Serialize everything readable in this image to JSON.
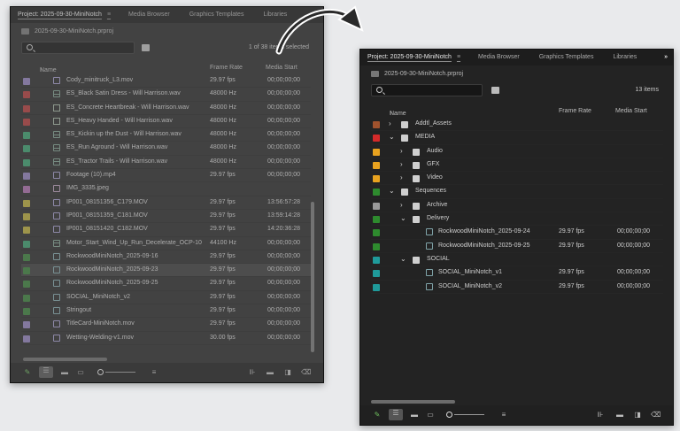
{
  "left_panel": {
    "tabs": [
      {
        "label": "Project: 2025-09-30-MiniNotch",
        "active": true
      },
      {
        "label": "Media Browser"
      },
      {
        "label": "Graphics Templates"
      },
      {
        "label": "Libraries"
      }
    ],
    "project_file": "2025-09-30-MiniNotch.prproj",
    "item_count": "1 of 38 items selected",
    "columns": {
      "name": "Name",
      "frame_rate": "Frame Rate",
      "media_start": "Media Start"
    },
    "rows": [
      {
        "color": "#8f7fb8",
        "icon": "video-icon",
        "name": "Cody_minitruck_L3.mov",
        "frame_rate": "29.97 fps",
        "media_start": "00;00;00;00"
      },
      {
        "color": "#b03a3a",
        "icon": "audio-icon",
        "name": "ES_Black Satin Dress - Will Harrison.wav",
        "frame_rate": "48000 Hz",
        "media_start": "00;00;00;00"
      },
      {
        "color": "#b03a3a",
        "icon": "file-icon",
        "name": "ES_Concrete Heartbreak - Will Harrison.wav",
        "frame_rate": "48000 Hz",
        "media_start": "00;00;00;00"
      },
      {
        "color": "#b03a3a",
        "icon": "file-icon",
        "name": "ES_Heavy Handed - Will Harrison.wav",
        "frame_rate": "48000 Hz",
        "media_start": "00;00;00;00"
      },
      {
        "color": "#3a9c6c",
        "icon": "audio-icon",
        "name": "ES_Kickin up the Dust - Will Harrison.wav",
        "frame_rate": "48000 Hz",
        "media_start": "00;00;00;00"
      },
      {
        "color": "#3a9c6c",
        "icon": "audio-icon",
        "name": "ES_Run Aground - Will Harrison.wav",
        "frame_rate": "48000 Hz",
        "media_start": "00;00;00;00"
      },
      {
        "color": "#3a9c6c",
        "icon": "audio-icon",
        "name": "ES_Tractor Trails - Will Harrison.wav",
        "frame_rate": "48000 Hz",
        "media_start": "00;00;00;00"
      },
      {
        "color": "#8f7fb8",
        "icon": "video-icon",
        "name": "Footage (10).mp4",
        "frame_rate": "29.97 fps",
        "media_start": "00;00;00;00"
      },
      {
        "color": "#a86aa8",
        "icon": "image-icon",
        "name": "IMG_3335.jpeg",
        "frame_rate": "",
        "media_start": ""
      },
      {
        "color": "#b7a93a",
        "icon": "video-icon",
        "name": "IP001_08151356_C179.MOV",
        "frame_rate": "29.97 fps",
        "media_start": "13:56:57:28"
      },
      {
        "color": "#b7a93a",
        "icon": "video-icon",
        "name": "IP001_08151359_C181.MOV",
        "frame_rate": "29.97 fps",
        "media_start": "13:59:14:28"
      },
      {
        "color": "#b7a93a",
        "icon": "video-icon",
        "name": "IP001_08151420_C182.MOV",
        "frame_rate": "29.97 fps",
        "media_start": "14:20:36:28"
      },
      {
        "color": "#3a9c6c",
        "icon": "audio-icon",
        "name": "Motor_Start_Wind_Up_Run_Decelerate_OCP-10",
        "frame_rate": "44100 Hz",
        "media_start": "00;00;00;00"
      },
      {
        "color": "#3a7f3a",
        "icon": "sequence-icon",
        "name": "RockwoodMiniNotch_2025-09-16",
        "frame_rate": "29.97 fps",
        "media_start": "00;00;00;00"
      },
      {
        "color": "#3a7f3a",
        "icon": "sequence-icon",
        "name": "RockwoodMiniNotch_2025-09-23",
        "frame_rate": "29.97 fps",
        "media_start": "00;00;00;00",
        "highlight": true
      },
      {
        "color": "#3a7f3a",
        "icon": "sequence-icon",
        "name": "RockwoodMiniNotch_2025-09-25",
        "frame_rate": "29.97 fps",
        "media_start": "00;00;00;00"
      },
      {
        "color": "#3a7f3a",
        "icon": "sequence-icon",
        "name": "SOCIAL_MiniNotch_v2",
        "frame_rate": "29.97 fps",
        "media_start": "00;00;00;00"
      },
      {
        "color": "#3a7f3a",
        "icon": "sequence-icon",
        "name": "Stringout",
        "frame_rate": "29.97 fps",
        "media_start": "00;00;00;00"
      },
      {
        "color": "#8f7fb8",
        "icon": "video-icon",
        "name": "TitleCard-MiniNotch.mov",
        "frame_rate": "29.97 fps",
        "media_start": "00;00;00;00"
      },
      {
        "color": "#8f7fb8",
        "icon": "video-icon",
        "name": "Wetting-Welding-v1.mov",
        "frame_rate": "30.00 fps",
        "media_start": "00;00;00;00"
      }
    ]
  },
  "right_panel": {
    "tabs": [
      {
        "label": "Project: 2025-09-30-MiniNotch",
        "active": true
      },
      {
        "label": "Media Browser"
      },
      {
        "label": "Graphics Templates"
      },
      {
        "label": "Libraries"
      }
    ],
    "more_label": "»",
    "project_file": "2025-09-30-MiniNotch.prproj",
    "item_count": "13 items",
    "columns": {
      "name": "Name",
      "frame_rate": "Frame Rate",
      "media_start": "Media Start"
    },
    "rows": [
      {
        "color": "#a0522d",
        "depth": 0,
        "type": "folder",
        "expand": "›",
        "name": "Addtl_Assets",
        "frame_rate": "",
        "media_start": ""
      },
      {
        "color": "#d42a2a",
        "depth": 0,
        "type": "folder",
        "expand": "⌄",
        "name": "MEDIA",
        "frame_rate": "",
        "media_start": ""
      },
      {
        "color": "#e8a21f",
        "depth": 1,
        "type": "folder",
        "expand": "›",
        "name": "Audio",
        "frame_rate": "",
        "media_start": ""
      },
      {
        "color": "#e8a21f",
        "depth": 1,
        "type": "folder",
        "expand": "›",
        "name": "GFX",
        "frame_rate": "",
        "media_start": ""
      },
      {
        "color": "#e8a21f",
        "depth": 1,
        "type": "folder",
        "expand": "›",
        "name": "Video",
        "frame_rate": "",
        "media_start": ""
      },
      {
        "color": "#2e8b2e",
        "depth": 0,
        "type": "folder",
        "expand": "⌄",
        "name": "Sequences",
        "frame_rate": "",
        "media_start": ""
      },
      {
        "color": "#9a9a9a",
        "depth": 1,
        "type": "folder",
        "expand": "›",
        "name": "Archive",
        "frame_rate": "",
        "media_start": ""
      },
      {
        "color": "#2e8b2e",
        "depth": 1,
        "type": "folder",
        "expand": "⌄",
        "name": "Delivery",
        "frame_rate": "",
        "media_start": ""
      },
      {
        "color": "#2e8b2e",
        "depth": 2,
        "type": "sequence",
        "expand": "",
        "name": "RockwoodMiniNotch_2025-09-24",
        "frame_rate": "29.97 fps",
        "media_start": "00;00;00;00"
      },
      {
        "color": "#2e8b2e",
        "depth": 2,
        "type": "sequence",
        "expand": "",
        "name": "RockwoodMiniNotch_2025-09-25",
        "frame_rate": "29.97 fps",
        "media_start": "00;00;00;00"
      },
      {
        "color": "#1f9a9a",
        "depth": 1,
        "type": "folder",
        "expand": "⌄",
        "name": "SOCIAL",
        "frame_rate": "",
        "media_start": ""
      },
      {
        "color": "#1f9a9a",
        "depth": 2,
        "type": "sequence",
        "expand": "",
        "name": "SOCIAL_MiniNotch_v1",
        "frame_rate": "29.97 fps",
        "media_start": "00;00;00;00"
      },
      {
        "color": "#1f9a9a",
        "depth": 2,
        "type": "sequence",
        "expand": "",
        "name": "SOCIAL_MiniNotch_v2",
        "frame_rate": "29.97 fps",
        "media_start": "00;00;00;00"
      }
    ]
  }
}
